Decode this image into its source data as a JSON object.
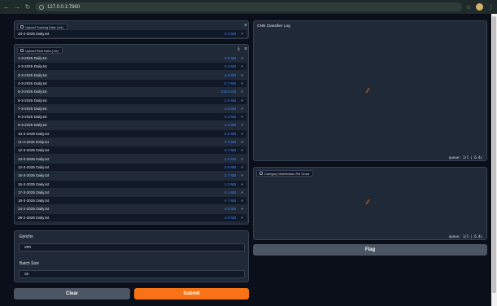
{
  "browser": {
    "url": "127.0.0.1:7860",
    "back_icon": "arrow-left-icon",
    "forward_icon": "arrow-right-icon",
    "reload_icon": "reload-icon"
  },
  "training_upload": {
    "label": "Upload Training Data (.txt)",
    "file": {
      "name": "23-2-2025 Daily.txt",
      "size": "3.4 MB"
    }
  },
  "real_upload": {
    "label": "Upload Real Data (.txt)",
    "files": [
      {
        "name": "1-3-2025 Daily.txt",
        "size": "3.8 MB"
      },
      {
        "name": "2-3-2025 Daily.txt",
        "size": "4.2 MB"
      },
      {
        "name": "3-3-2025 Daily.txt",
        "size": "4.3 MB"
      },
      {
        "name": "4-3-2025 Daily.txt",
        "size": "2.7 MB"
      },
      {
        "name": "5-3-2025 Daily.txt",
        "size": "216.0 KB"
      },
      {
        "name": "6-3-2025 Daily.txt",
        "size": "2.5 MB"
      },
      {
        "name": "7-3-2025 Daily.txt",
        "size": "3.8 MB"
      },
      {
        "name": "8-3-2025 Daily.txt",
        "size": "4.3 MB"
      },
      {
        "name": "9-3-2025 Daily.txt",
        "size": "4.2 MB"
      },
      {
        "name": "10-3-2025 Daily.txt",
        "size": "3.6 MB"
      },
      {
        "name": "11-3-2025 Daily.txt",
        "size": "3.2 MB"
      },
      {
        "name": "12-3-2025 Daily.txt",
        "size": "3.7 MB"
      },
      {
        "name": "13-3-2025 Daily.txt",
        "size": "3.5 MB"
      },
      {
        "name": "14-3-2025 Daily.txt",
        "size": "3.6 MB"
      },
      {
        "name": "15-3-2025 Daily.txt",
        "size": "3.7 MB"
      },
      {
        "name": "16-3-2025 Daily.txt",
        "size": "1.2 MB"
      },
      {
        "name": "17-3-2025 Daily.txt",
        "size": "4.1 MB"
      },
      {
        "name": "18-3-2025 Daily.txt",
        "size": "4.7 MB"
      },
      {
        "name": "24-2-2025 Daily.txt",
        "size": "4.6 MB"
      },
      {
        "name": "28-2-2025 Daily.txt",
        "size": "4.6 MB"
      }
    ]
  },
  "params": {
    "epochs_label": "Epochs",
    "epochs_value": "200",
    "batch_label": "Batch Size",
    "batch_value": "32"
  },
  "buttons": {
    "clear": "Clear",
    "submit": "Submit",
    "flag": "Flag"
  },
  "log_panel": {
    "title": "CNN Classifier Log",
    "queue": "queue: 1/1 | 6.4s"
  },
  "chart_panel": {
    "title": "Category Distribution Pie Chart",
    "queue": "queue: 1/1 | 6.4s"
  },
  "colors": {
    "accent": "#f97316",
    "link": "#3b82f6",
    "bg": "#0b0f19",
    "panel": "#1f2937"
  }
}
